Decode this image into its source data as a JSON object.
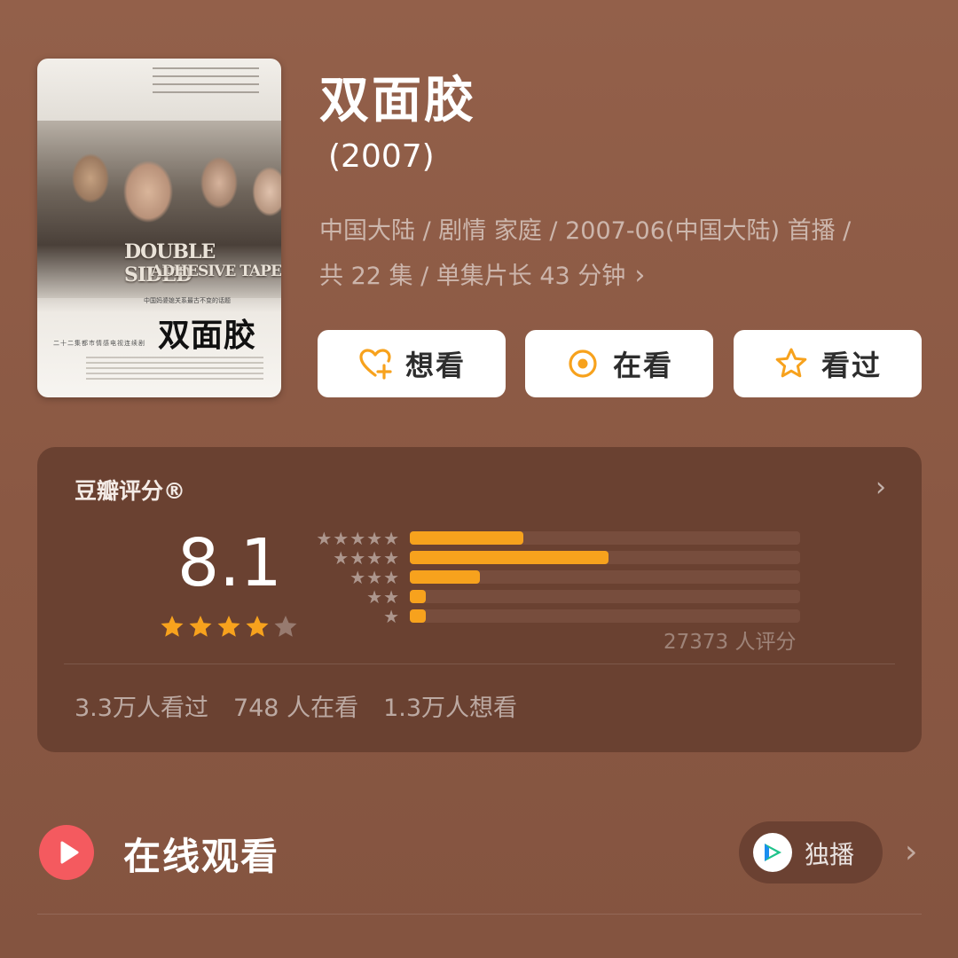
{
  "poster": {
    "english_line1": "DOUBLE SIDED",
    "english_line2": "ADHESIVE TAPE",
    "tagline": "中国妈婆媳关系最古不变的话题",
    "chinese_title": "双面胶",
    "subtitle": "二十二集都市情感电视连续剧"
  },
  "movie": {
    "title": "双面胶",
    "year": "(2007)",
    "meta_line1": "中国大陆 / 剧情 家庭 / 2007-06(中国大陆) 首播 /",
    "meta_line2": "共 22 集 / 单集片长 43 分钟"
  },
  "actions": {
    "want": "想看",
    "watching": "在看",
    "watched": "看过"
  },
  "rating": {
    "header": "豆瓣评分®",
    "score": "8.1",
    "star_value": 4,
    "distribution": [
      {
        "stars": 5,
        "fraction": 0.29
      },
      {
        "stars": 4,
        "fraction": 0.51
      },
      {
        "stars": 3,
        "fraction": 0.18
      },
      {
        "stars": 2,
        "fraction": 0.04
      },
      {
        "stars": 1,
        "fraction": 0.04
      }
    ],
    "count_text": "27373 人评分",
    "watched": "3.3万人看过",
    "watching": "748 人在看",
    "want": "1.3万人想看"
  },
  "online": {
    "title": "在线观看",
    "platform_label": "独播"
  },
  "colors": {
    "accent_orange": "#f7a21d",
    "play_red": "#f45a5f",
    "card_bg": "#6a4131"
  }
}
